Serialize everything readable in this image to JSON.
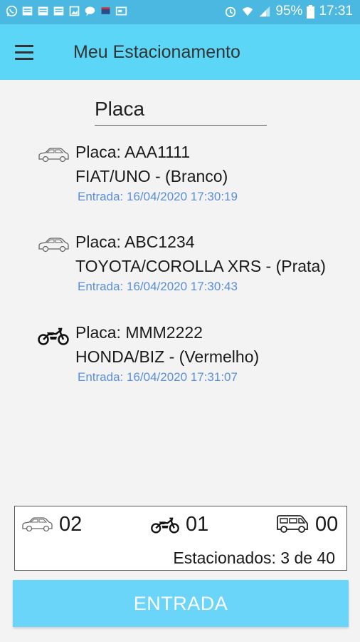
{
  "status_bar": {
    "battery": "95%",
    "time": "17:31",
    "notification_icons": [
      "whatsapp-icon",
      "doc-icon",
      "doc-icon",
      "doc-icon",
      "image-icon",
      "chat-icon",
      "flag-icon",
      "card-icon"
    ]
  },
  "app_bar": {
    "title": "Meu Estacionamento"
  },
  "search": {
    "placeholder": "Placa"
  },
  "vehicles": [
    {
      "type": "car",
      "plate": "Placa: AAA1111",
      "model": "FIAT/UNO - (Branco)",
      "entry": "Entrada: 16/04/2020 17:30:19"
    },
    {
      "type": "car",
      "plate": "Placa: ABC1234",
      "model": "TOYOTA/COROLLA XRS - (Prata)",
      "entry": "Entrada: 16/04/2020 17:30:43"
    },
    {
      "type": "motorcycle",
      "plate": "Placa: MMM2222",
      "model": "HONDA/BIZ - (Vermelho)",
      "entry": "Entrada: 16/04/2020 17:31:07"
    }
  ],
  "summary": {
    "cars": "02",
    "motorcycles": "01",
    "vans": "00",
    "total": "Estacionados: 3 de 40"
  },
  "button": {
    "label": "ENTRADA"
  },
  "colors": {
    "status_bar": "#4ab8e0",
    "app_bar": "#5cd6f7",
    "button": "#6ad4f9",
    "entry_text": "#5a8ed8"
  }
}
